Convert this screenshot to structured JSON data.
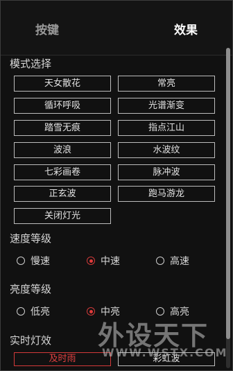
{
  "tabs": [
    {
      "label": "按键",
      "active": false
    },
    {
      "label": "效果",
      "active": true
    }
  ],
  "mode_section": {
    "title": "模式选择",
    "buttons": [
      "天女散花",
      "常亮",
      "循环呼吸",
      "光谱渐变",
      "踏雪无痕",
      "指点江山",
      "波浪",
      "水波纹",
      "七彩画卷",
      "脉冲波",
      "正玄波",
      "跑马游龙",
      "关闭灯光"
    ]
  },
  "speed_section": {
    "title": "速度等级",
    "options": [
      "慢速",
      "中速",
      "高速"
    ],
    "selected": "中速"
  },
  "brightness_section": {
    "title": "亮度等级",
    "options": [
      "低亮",
      "中亮",
      "高亮"
    ],
    "selected": "中亮"
  },
  "live_section": {
    "title": "实时灯效",
    "buttons": [
      "及时雨",
      "彩虹波"
    ],
    "active_color": "#e04040"
  },
  "watermark": {
    "text": "外设天下",
    "sub": "WWW.WSTX.COM"
  },
  "colors": {
    "background": "#111111",
    "accent": "#e23b3b",
    "border": "#bdbdbd"
  }
}
